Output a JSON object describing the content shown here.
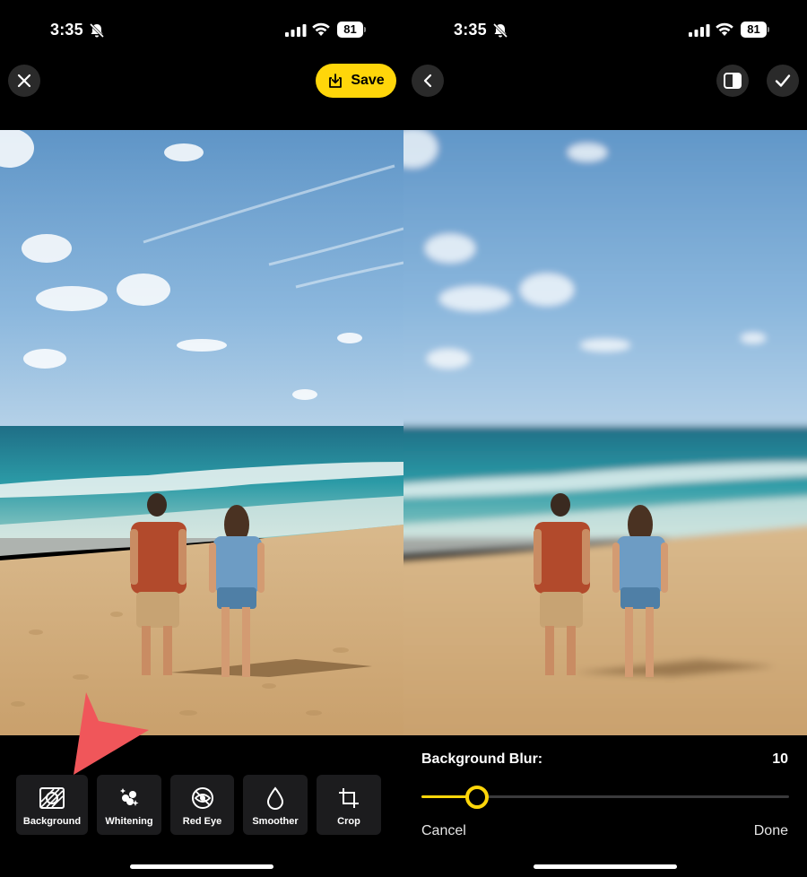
{
  "left": {
    "status": {
      "time": "3:35",
      "battery": "81"
    },
    "header": {
      "save_label": "Save"
    },
    "tools": [
      {
        "label": "Background",
        "icon": "background-icon"
      },
      {
        "label": "Whitening",
        "icon": "sparkles-icon"
      },
      {
        "label": "Red Eye",
        "icon": "eye-icon"
      },
      {
        "label": "Smoother",
        "icon": "droplet-icon"
      },
      {
        "label": "Crop",
        "icon": "crop-icon"
      }
    ]
  },
  "right": {
    "status": {
      "time": "3:35",
      "battery": "81"
    },
    "adjust": {
      "title": "Background Blur:",
      "value": "10",
      "slider_fraction": 0.12,
      "cancel_label": "Cancel",
      "done_label": "Done"
    }
  },
  "colors": {
    "accent": "#ffd60a",
    "arrow": "#f0565a",
    "tool_bg": "#1c1c1e"
  }
}
